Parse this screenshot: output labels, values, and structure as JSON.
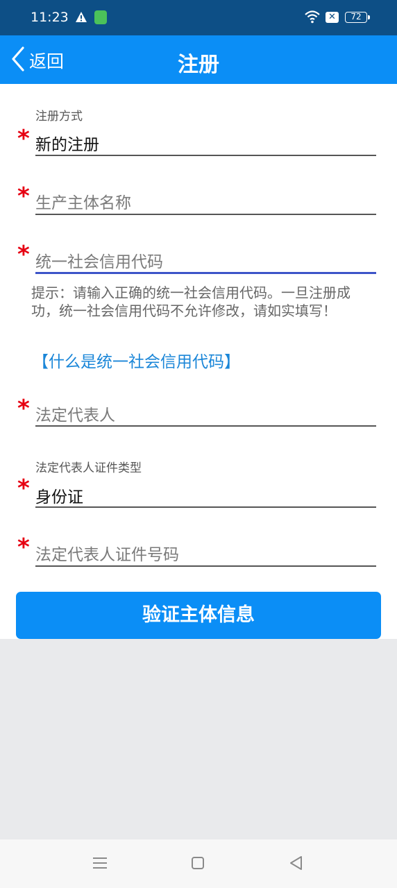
{
  "status_bar": {
    "time": "11:23",
    "battery": "72",
    "icons": [
      "warning-icon",
      "app-icon",
      "wifi-icon",
      "sim-x-icon",
      "battery-icon"
    ]
  },
  "header": {
    "back_label": "返回",
    "title": "注册",
    "background_color": "#0b8ef6"
  },
  "form": {
    "register_mode": {
      "label": "注册方式",
      "value": "新的注册"
    },
    "entity_name": {
      "placeholder": "生产主体名称"
    },
    "credit_code": {
      "placeholder": "统一社会信用代码",
      "hint": "提示：请输入正确的统一社会信用代码。一旦注册成功，统一社会信用代码不允许修改，请如实填写！",
      "link": "【什么是统一社会信用代码】"
    },
    "legal_rep": {
      "placeholder": "法定代表人"
    },
    "id_type": {
      "label": "法定代表人证件类型",
      "value": "身份证"
    },
    "id_number": {
      "placeholder": "法定代表人证件号码"
    },
    "required_mark": "*",
    "submit_label": "验证主体信息"
  },
  "system_nav": {
    "icons": [
      "menu-icon",
      "home-icon",
      "back-triangle-icon"
    ]
  },
  "colors": {
    "accent": "#0b8ef6",
    "required": "#e60012",
    "link": "#1a86d8",
    "status_bar": "#0d4f86"
  }
}
